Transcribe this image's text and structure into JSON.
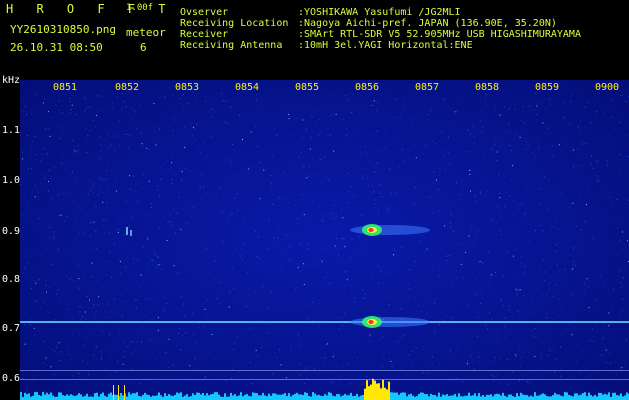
{
  "app": {
    "logo": "H R O F F T",
    "version": "1.00f",
    "filename": "YY2610310850.png",
    "datetime": "26.10.31 08:50",
    "meteor_label": "meteor",
    "meteor_count": "6"
  },
  "station": {
    "observer_label": "Ovserver",
    "observer_value": ":YOSHIKAWA Yasufumi /JG2MLI",
    "location_label": "Receiving Location",
    "location_value": ":Nagoya Aichi-pref. JAPAN (136.90E, 35.20N)",
    "receiver_label": "Receiver",
    "receiver_value": ":SMArt RTL-SDR V5 52.905MHz USB HIGASHIMURAYAMA",
    "antenna_label": "Receiving Antenna",
    "antenna_value": ":10mH 3el.YAGI Horizontal:ENE"
  },
  "spectrogram": {
    "y_unit": "kHz",
    "y_ticks": [
      "1.1",
      "1.0",
      "0.9",
      "0.8",
      "0.7",
      "0.6"
    ],
    "x_ticks": [
      "0851",
      "0852",
      "0853",
      "0854",
      "0855",
      "0856",
      "0857",
      "0858",
      "0859",
      "0900"
    ],
    "colors": {
      "background": "#061490",
      "carrier": "#6fe8ff",
      "meteor_core": "#ff2a2a",
      "meteor_mid": "#ffee33",
      "meteor_edge": "#33ff66",
      "noise_floor": "#12c8ff",
      "peak": "#ffe800"
    }
  }
}
